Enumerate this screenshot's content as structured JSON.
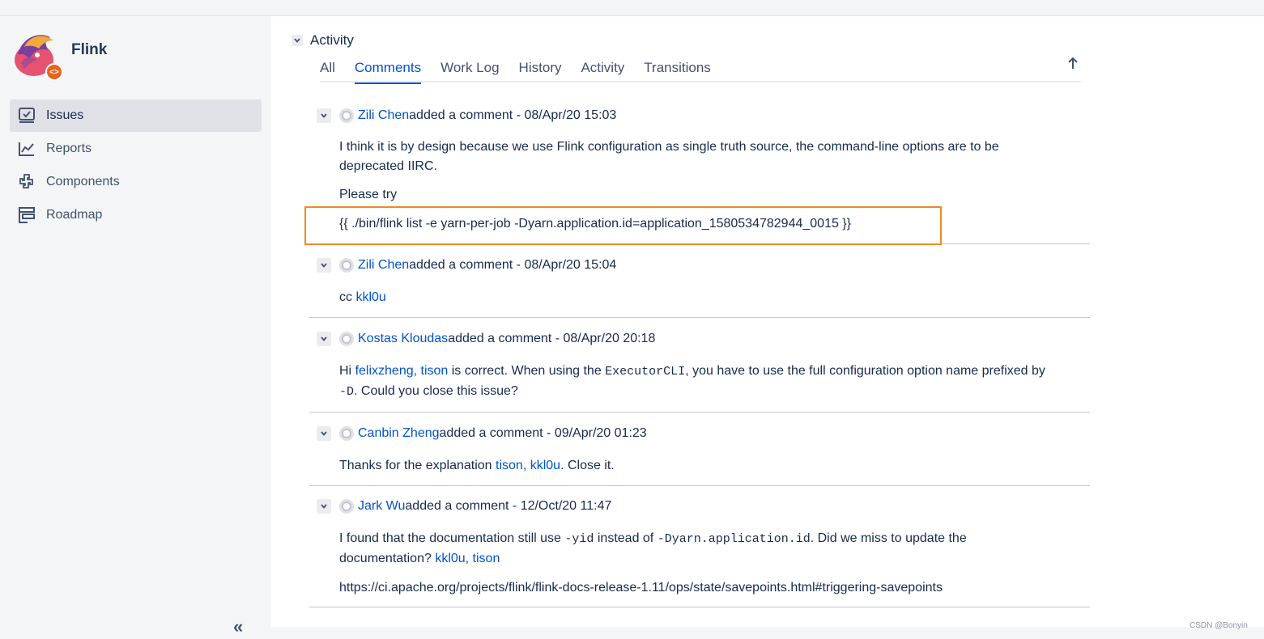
{
  "project": {
    "name": "Flink",
    "badge": "<>"
  },
  "nav": [
    {
      "label": "Issues",
      "icon": "issues-icon"
    },
    {
      "label": "Reports",
      "icon": "reports-icon"
    },
    {
      "label": "Components",
      "icon": "components-icon"
    },
    {
      "label": "Roadmap",
      "icon": "roadmap-icon"
    }
  ],
  "collapse_label": "«",
  "activity": {
    "title": "Activity",
    "tabs": [
      "All",
      "Comments",
      "Work Log",
      "History",
      "Activity",
      "Transitions"
    ],
    "active_tab": "Comments"
  },
  "comments": [
    {
      "author": "Zili Chen",
      "meta": " added a comment - 08/Apr/20 15:03",
      "line1": "I think it is by design because we use Flink configuration as single truth source, the command-line options are to be",
      "line2": "deprecated IIRC.",
      "line3": "Please try",
      "code": "{{ ./bin/flink list -e yarn-per-job -Dyarn.application.id=application_1580534782944_0015 }}"
    },
    {
      "author": "Zili Chen",
      "meta": " added a comment - 08/Apr/20 15:04",
      "prefix": "cc ",
      "mention": "kkl0u"
    },
    {
      "author": "Kostas Kloudas",
      "meta": " added a comment - 08/Apr/20 20:18",
      "hi": "Hi ",
      "mentions": "felixzheng, tison",
      "text_a": " is correct. When using the ",
      "code_a": "ExecutorCLI",
      "text_b": ", you have to use the full configuration option name prefixed by",
      "code_b": "-D",
      "text_c": ". Could you close this issue?"
    },
    {
      "author": "Canbin Zheng",
      "meta": " added a comment - 09/Apr/20 01:23",
      "text_a": "Thanks for the explanation ",
      "mentions": "tison, kkl0u",
      "text_b": ". Close it."
    },
    {
      "author": "Jark Wu",
      "meta": " added a comment - 12/Oct/20 11:47",
      "text_a": "I found that the documentation still use ",
      "code_a": "-yid",
      "text_b": " instead of ",
      "code_b": "-Dyarn.application.id",
      "text_c": ". Did we miss to update the",
      "text_d": "documentation? ",
      "mentions": "kkl0u, tison",
      "url": "https://ci.apache.org/projects/flink/flink-docs-release-1.11/ops/state/savepoints.html#triggering-savepoints"
    }
  ],
  "watermark": "CSDN @Bonyin",
  "colors": {
    "link": "#0052cc",
    "highlight": "#f08a24",
    "sidebar_bg": "#f4f5f7"
  }
}
